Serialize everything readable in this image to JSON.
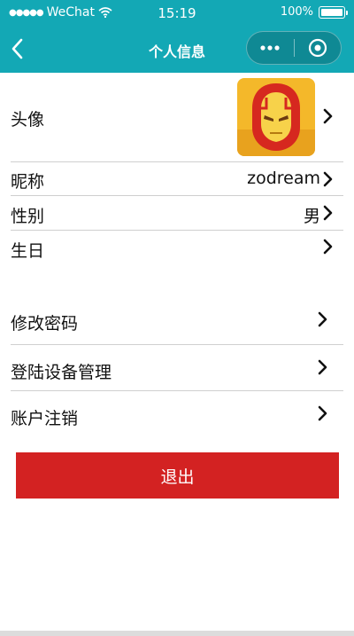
{
  "status_bar": {
    "signal": "●●●●●",
    "carrier": "WeChat",
    "time": "15:19",
    "battery": "100%"
  },
  "nav": {
    "title": "个人信息",
    "more_icon": "more-dots-icon",
    "close_icon": "mini-program-close-icon"
  },
  "profile": {
    "avatar": {
      "label": "头像"
    },
    "nickname": {
      "label": "昵称",
      "value": "zodream"
    },
    "gender": {
      "label": "性别",
      "value": "男"
    },
    "birthday": {
      "label": "生日",
      "value": ""
    }
  },
  "account": {
    "change_password": "修改密码",
    "device_management": "登陆设备管理",
    "deactivate": "账户注销"
  },
  "logout_label": "退出",
  "colors": {
    "header": "#13a8b5",
    "logout": "#d32222",
    "divider": "#cfcfcf"
  }
}
